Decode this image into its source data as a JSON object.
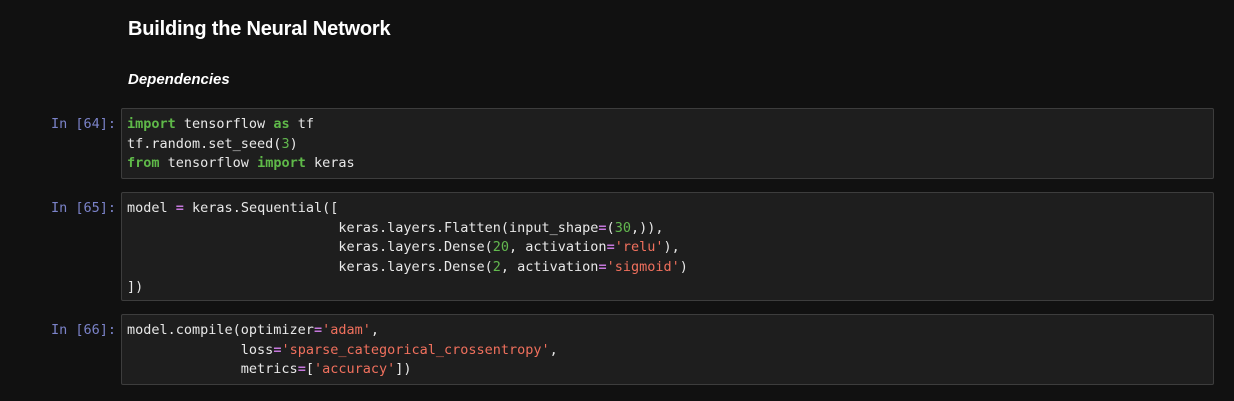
{
  "notebook": {
    "heading": "Building the Neural Network",
    "subheading": "Dependencies",
    "cells": [
      {
        "prompt": "In [64]:",
        "lines": [
          [
            {
              "t": "import",
              "c": "kw"
            },
            {
              "t": " tensorflow ",
              "c": ""
            },
            {
              "t": "as",
              "c": "kw"
            },
            {
              "t": " tf",
              "c": ""
            }
          ],
          [
            {
              "t": "tf.random.set_seed(",
              "c": ""
            },
            {
              "t": "3",
              "c": "num"
            },
            {
              "t": ")",
              "c": ""
            }
          ],
          [
            {
              "t": "from",
              "c": "kw"
            },
            {
              "t": " tensorflow ",
              "c": ""
            },
            {
              "t": "import",
              "c": "kw"
            },
            {
              "t": " keras",
              "c": ""
            }
          ]
        ]
      },
      {
        "prompt": "In [65]:",
        "lines": [
          [
            {
              "t": "model ",
              "c": ""
            },
            {
              "t": "=",
              "c": "op"
            },
            {
              "t": " keras.Sequential([",
              "c": ""
            }
          ],
          [
            {
              "t": "                          keras.layers.Flatten(input_shape",
              "c": ""
            },
            {
              "t": "=",
              "c": "op"
            },
            {
              "t": "(",
              "c": ""
            },
            {
              "t": "30",
              "c": "num"
            },
            {
              "t": ",)),",
              "c": ""
            }
          ],
          [
            {
              "t": "                          keras.layers.Dense(",
              "c": ""
            },
            {
              "t": "20",
              "c": "num"
            },
            {
              "t": ", activation",
              "c": ""
            },
            {
              "t": "=",
              "c": "op"
            },
            {
              "t": "'relu'",
              "c": "str"
            },
            {
              "t": "),",
              "c": ""
            }
          ],
          [
            {
              "t": "                          keras.layers.Dense(",
              "c": ""
            },
            {
              "t": "2",
              "c": "num"
            },
            {
              "t": ", activation",
              "c": ""
            },
            {
              "t": "=",
              "c": "op"
            },
            {
              "t": "'sigmoid'",
              "c": "str"
            },
            {
              "t": ")",
              "c": ""
            }
          ],
          [
            {
              "t": "])",
              "c": ""
            }
          ]
        ]
      },
      {
        "prompt": "In [66]:",
        "lines": [
          [
            {
              "t": "model.compile(optimizer",
              "c": ""
            },
            {
              "t": "=",
              "c": "op"
            },
            {
              "t": "'adam'",
              "c": "str"
            },
            {
              "t": ",",
              "c": ""
            }
          ],
          [
            {
              "t": "              loss",
              "c": ""
            },
            {
              "t": "=",
              "c": "op"
            },
            {
              "t": "'sparse_categorical_crossentropy'",
              "c": "str"
            },
            {
              "t": ",",
              "c": ""
            }
          ],
          [
            {
              "t": "              metrics",
              "c": ""
            },
            {
              "t": "=",
              "c": "op"
            },
            {
              "t": "[",
              "c": ""
            },
            {
              "t": "'accuracy'",
              "c": "str"
            },
            {
              "t": "])",
              "c": ""
            }
          ]
        ]
      }
    ]
  },
  "colors": {
    "background": "#111111",
    "cell_background": "#1e1e1e",
    "prompt": "#7b83c9",
    "keyword": "#5fb949",
    "operator": "#c678dd",
    "number": "#63b84f",
    "string": "#f0705d"
  }
}
